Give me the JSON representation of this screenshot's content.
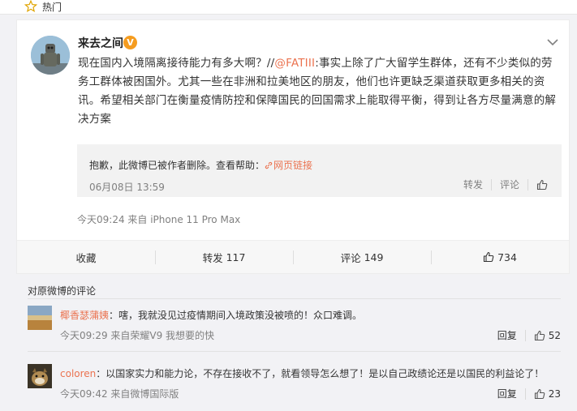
{
  "topbar": {
    "label": "热门"
  },
  "post": {
    "user_name": "来去之间",
    "verify_badge": "V",
    "text_lead": "现在国内入境隔离接待能力有多大啊？//",
    "mention": "@FATIII",
    "text_rest": ":事实上除了广大留学生群体，还有不少类似的劳务工群体被困国外。尤其一些在非洲和拉美地区的朋友，他们也许更缺乏渠道获取更多相关的资讯。希望相关部门在衡量疫情防控和保障国民的回国需求上能取得平衡，得到让各方尽量满意的解决方案",
    "quote": {
      "message": "抱歉，此微博已被作者删除。查看帮助：",
      "link_text": "网页链接",
      "date": "06月08日 13:59",
      "repost_label": "转发",
      "comment_label": "评论"
    },
    "meta": "今天09:24 来自 iPhone 11 Pro Max",
    "actions": {
      "favorite_label": "收藏",
      "repost_label": "转发",
      "repost_count": "117",
      "comment_label": "评论",
      "comment_count": "149",
      "like_count": "734"
    }
  },
  "comments": {
    "title": "对原微博的评论",
    "items": [
      {
        "name": "椰香瑟蒲姨",
        "text": "：嗐，我就没见过疫情期间入境政策没被喷的！众口难调。",
        "meta": "今天09:29 来自荣耀V9 我想要的快",
        "reply_label": "回复",
        "likes": "52"
      },
      {
        "name": "coloren",
        "text": "：以国家实力和能力论，不存在接收不了，就看领导怎么想了！是以自己政绩论还是以国民的利益论了！",
        "meta": "今天09:42 来自微博国际版",
        "reply_label": "回复",
        "likes": "23"
      }
    ]
  },
  "colors": {
    "accent": "#eb7350",
    "badge": "#f59c1f",
    "muted": "#808080"
  },
  "icons": [
    "star-icon",
    "chevron-down-icon",
    "link-icon",
    "thumbs-up-icon"
  ]
}
